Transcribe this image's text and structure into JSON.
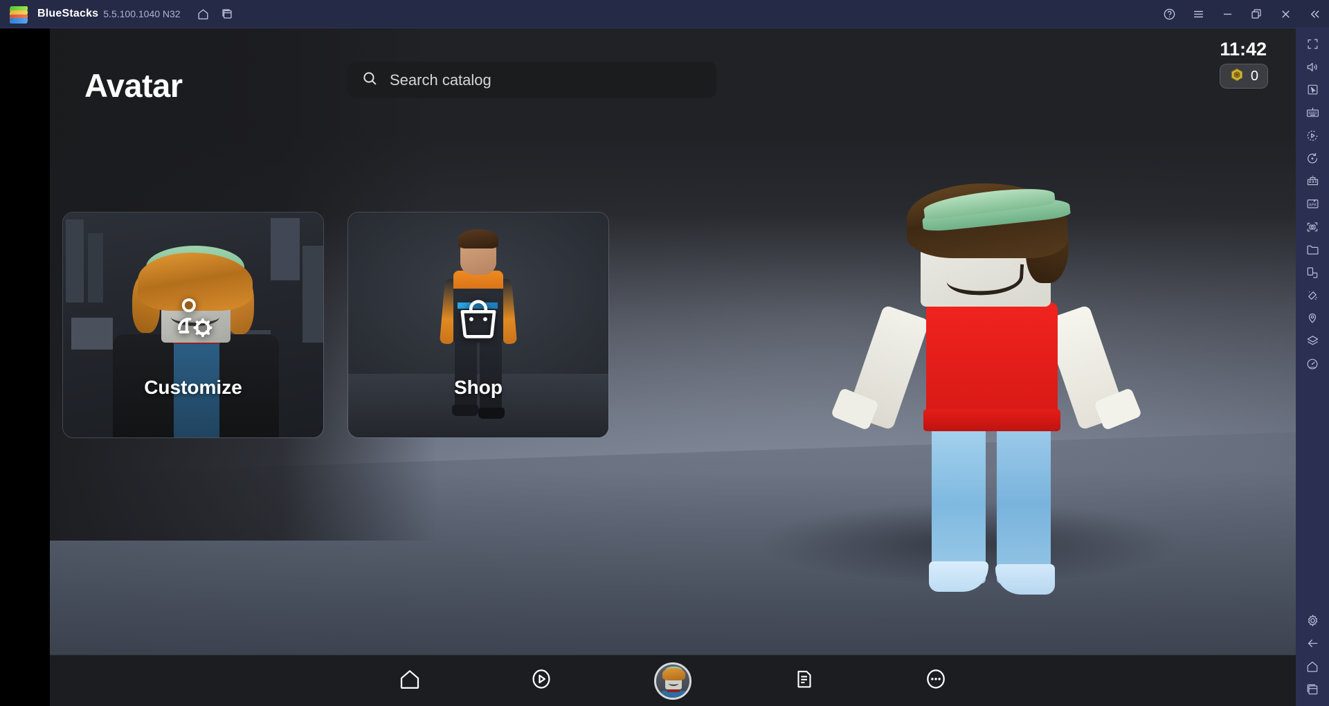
{
  "titlebar": {
    "app_name": "BlueStacks",
    "version": "5.5.100.1040 N32",
    "icons": {
      "logo": "bluestacks-logo",
      "home": "home-icon",
      "instances": "multi-instance-icon",
      "help": "help-circle-icon",
      "menu": "hamburger-menu-icon",
      "minimize": "minimize-icon",
      "restore": "restore-window-icon",
      "close": "close-icon",
      "collapse": "collapse-chevrons-icon"
    },
    "accent_bg": "#252a47"
  },
  "sidebar": {
    "items": [
      {
        "name": "fullscreen-icon",
        "label": "Full screen"
      },
      {
        "name": "volume-icon",
        "label": "Volume"
      },
      {
        "name": "pointer-icon",
        "label": "Game controls"
      },
      {
        "name": "keyboard-icon",
        "label": "Keyboard controls"
      },
      {
        "name": "macro-record-icon",
        "label": "Macro recorder"
      },
      {
        "name": "sync-operations-icon",
        "label": "Sync operations"
      },
      {
        "name": "multi-instance-manager-icon",
        "label": "Multi-instance manager"
      },
      {
        "name": "install-apk-icon",
        "label": "Install APK"
      },
      {
        "name": "screenshot-icon",
        "label": "Screenshot"
      },
      {
        "name": "media-folder-icon",
        "label": "Media manager"
      },
      {
        "name": "rotate-screen-icon",
        "label": "Rotate"
      },
      {
        "name": "shake-icon",
        "label": "Shake"
      },
      {
        "name": "location-icon",
        "label": "Location"
      },
      {
        "name": "eco-mode-icon",
        "label": "Eco mode"
      },
      {
        "name": "performance-meter-icon",
        "label": "Performance"
      },
      {
        "name": "settings-gear-icon",
        "label": "Settings"
      },
      {
        "name": "back-arrow-icon",
        "label": "Back"
      },
      {
        "name": "android-home-icon",
        "label": "Home"
      },
      {
        "name": "recent-apps-icon",
        "label": "Recent apps"
      }
    ]
  },
  "app": {
    "page_title": "Avatar",
    "search": {
      "placeholder": "Search catalog",
      "icon": "search-icon"
    },
    "status": {
      "clock": "11:42",
      "currency_icon": "robux-icon",
      "currency_amount": "0",
      "currency_color": "#c9a227"
    },
    "cards": [
      {
        "label": "Customize",
        "icon": "person-gear-icon"
      },
      {
        "label": "Shop",
        "icon": "shopping-bag-icon"
      }
    ],
    "bottom_nav": [
      {
        "name": "nav-home",
        "icon": "home-icon",
        "selected": false
      },
      {
        "name": "nav-discover",
        "icon": "circle-play-icon",
        "selected": false
      },
      {
        "name": "nav-avatar",
        "icon": "avatar-thumbnail",
        "selected": true
      },
      {
        "name": "nav-chat",
        "icon": "chat-list-icon",
        "selected": false
      },
      {
        "name": "nav-more",
        "icon": "ellipsis-circle-icon",
        "selected": false
      }
    ],
    "avatar_preview": {
      "hat_color": "#8fc9a1",
      "hair_color": "#4a3118",
      "shirt_color": "#e61c18",
      "pants_color": "#8cc0e4",
      "skin_color": "#eeede6"
    }
  }
}
